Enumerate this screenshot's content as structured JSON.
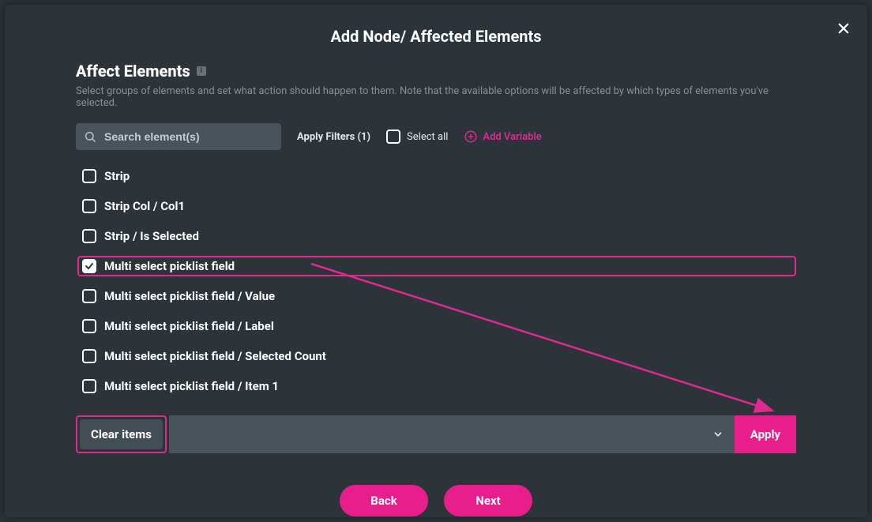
{
  "modal": {
    "title": "Add Node/ Affected Elements"
  },
  "section": {
    "heading": "Affect Elements",
    "subtext": "Select groups of elements and set what action should happen to them. Note that the available options will be affected by which types of elements you've selected."
  },
  "filters": {
    "search_placeholder": "Search element(s)",
    "apply_filters_label": "Apply Filters (1)",
    "select_all_label": "Select all",
    "add_variable_label": "Add Variable"
  },
  "elements": [
    {
      "label": "Strip",
      "checked": false,
      "highlight": false,
      "chip": null
    },
    {
      "label": "Strip Col / Col1",
      "checked": false,
      "highlight": false,
      "chip": null
    },
    {
      "label": "Strip / Is Selected",
      "checked": false,
      "highlight": false,
      "chip": null
    },
    {
      "label": "Multi select picklist field",
      "checked": true,
      "highlight": true,
      "chip": "Clear items"
    },
    {
      "label": "Multi select picklist field / Value",
      "checked": false,
      "highlight": false,
      "chip": null
    },
    {
      "label": "Multi select picklist field / Label",
      "checked": false,
      "highlight": false,
      "chip": null
    },
    {
      "label": "Multi select picklist field / Selected Count",
      "checked": false,
      "highlight": false,
      "chip": null
    },
    {
      "label": "Multi select picklist field / Item 1",
      "checked": false,
      "highlight": false,
      "chip": null
    }
  ],
  "action": {
    "selected_label": "Clear items",
    "apply_label": "Apply"
  },
  "footer": {
    "back_label": "Back",
    "next_label": "Next"
  },
  "colors": {
    "accent": "#e81e8c",
    "bg": "#2c343a",
    "chip_bg": "#606a72",
    "field_bg": "#48535b"
  }
}
